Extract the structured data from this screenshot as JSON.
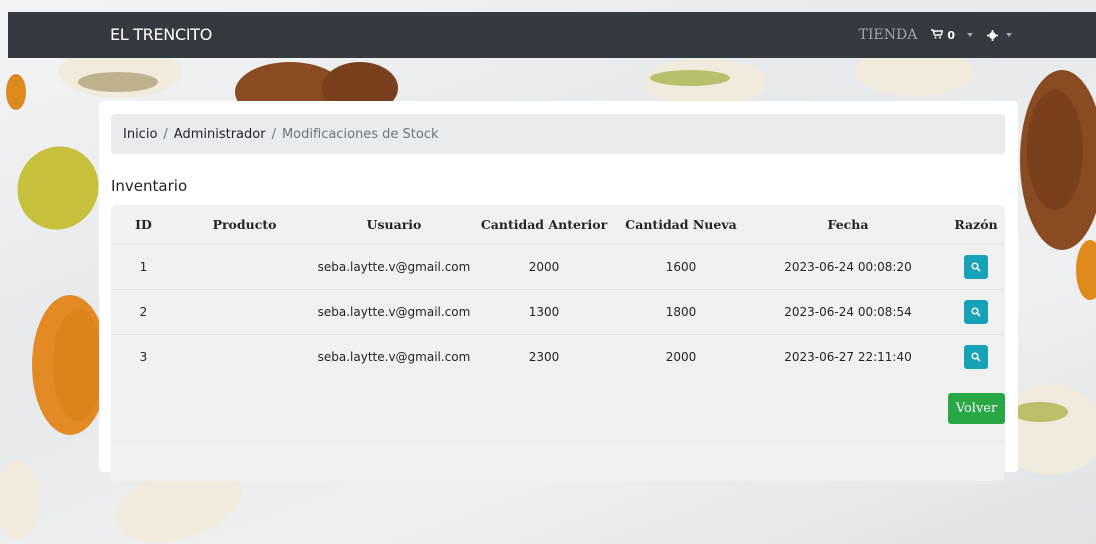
{
  "navbar": {
    "brand": "EL TRENCITO",
    "store_label": "TIENDA",
    "cart_count": "0"
  },
  "breadcrumb": {
    "items": [
      "Inicio",
      "Administrador"
    ],
    "active": "Modificaciones de Stock",
    "separator": "/"
  },
  "section_title": "Inventario",
  "table": {
    "headers": [
      "ID",
      "Producto",
      "Usuario",
      "Cantidad Anterior",
      "Cantidad Nueva",
      "Fecha",
      "Razón"
    ],
    "rows": [
      {
        "id": "1",
        "producto": "",
        "usuario": "seba.laytte.v@gmail.com",
        "anterior": "2000",
        "nueva": "1600",
        "fecha": "2023-06-24 00:08:20"
      },
      {
        "id": "2",
        "producto": "",
        "usuario": "seba.laytte.v@gmail.com",
        "anterior": "1300",
        "nueva": "1800",
        "fecha": "2023-06-24 00:08:54"
      },
      {
        "id": "3",
        "producto": "",
        "usuario": "seba.laytte.v@gmail.com",
        "anterior": "2300",
        "nueva": "2000",
        "fecha": "2023-06-27 22:11:40"
      }
    ]
  },
  "buttons": {
    "volver": "Volver"
  },
  "colors": {
    "navbar": "#343a40",
    "info": "#17a2b8",
    "success": "#28a745"
  }
}
